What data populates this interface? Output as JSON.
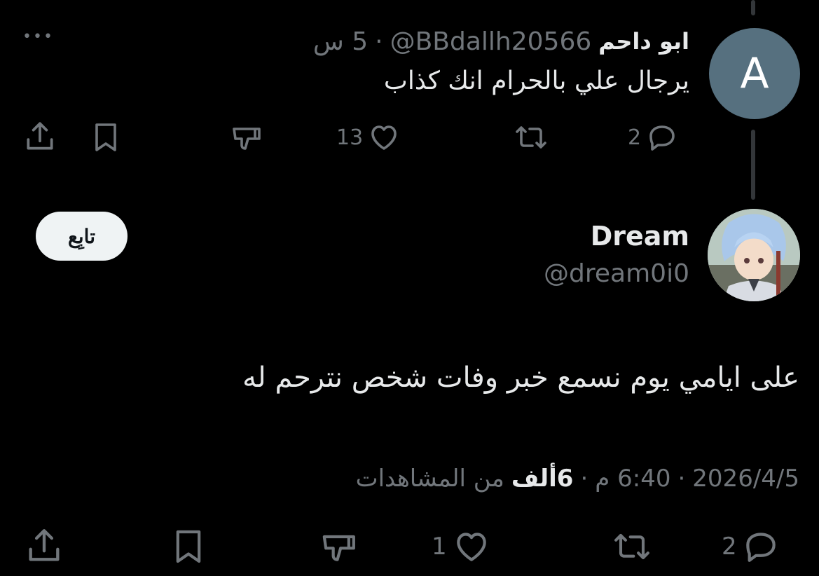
{
  "reply": {
    "avatar_letter": "A",
    "display_name": "ابو داحم",
    "handle": "@BBdallh20566",
    "time": "5 س",
    "separator": "·",
    "text": "يرجال علي بالحرام انك كذاب",
    "actions": {
      "replies": "2",
      "reposts": "",
      "likes": "13"
    },
    "more_label": "•••"
  },
  "main": {
    "display_name": "Dream",
    "handle": "@dream0i0",
    "follow_label": "تابِع",
    "text": "على ايامي يوم نسمع خبر وفات شخص نترحم له",
    "meta": {
      "date": "2026/4/5",
      "time": "6:40 م",
      "views_count": "6ألف",
      "views_label": "من المشاهدات",
      "separator": "·"
    },
    "actions": {
      "replies": "2",
      "reposts": "",
      "likes": "1"
    }
  },
  "colors": {
    "background": "#000000",
    "text": "#e7e9ea",
    "muted": "#71767b",
    "avatar_a": "#56707f"
  },
  "icons": [
    "reply-icon",
    "repost-icon",
    "like-icon",
    "dislike-icon",
    "bookmark-icon",
    "share-icon",
    "more-icon"
  ]
}
